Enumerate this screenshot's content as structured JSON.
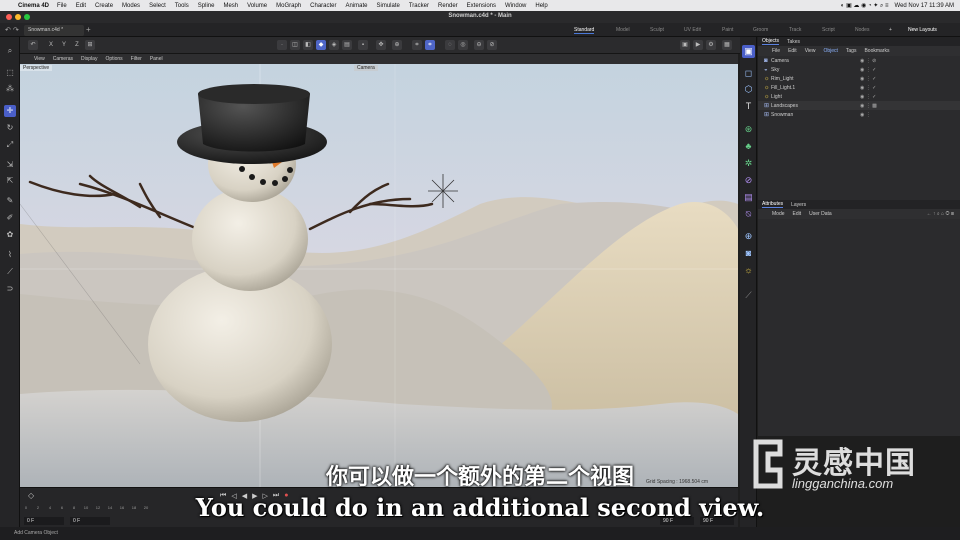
{
  "menubar": {
    "app": "Cinema 4D",
    "items": [
      "File",
      "Edit",
      "Create",
      "Modes",
      "Select",
      "Tools",
      "Spline",
      "Mesh",
      "Volume",
      "MoGraph",
      "Character",
      "Animate",
      "Simulate",
      "Tracker",
      "Render",
      "Extensions",
      "Window",
      "Help"
    ],
    "clock": "Wed Nov 17  11:39 AM"
  },
  "window": {
    "title": "Snowman.c4d * - Main"
  },
  "doc_tab": {
    "label": "Snowman.c4d *"
  },
  "layouts": {
    "items": [
      "Standard",
      "Model",
      "Sculpt",
      "UV Edit",
      "Paint",
      "Groom",
      "Track",
      "Script",
      "Nodes"
    ],
    "new_layouts": "New Layouts"
  },
  "axis_buttons": [
    "X",
    "Y",
    "Z"
  ],
  "viewport": {
    "menu": [
      "View",
      "Cameras",
      "Display",
      "Options",
      "Filter",
      "Panel"
    ],
    "perspective_label": "Perspective",
    "camera_label": "Camera",
    "grid_spacing": "Grid Spacing : 1968.504 cm"
  },
  "objects_panel": {
    "tabs": [
      "Objects",
      "Takes"
    ],
    "menu": [
      "File",
      "Edit",
      "View",
      "Object",
      "Tags",
      "Bookmarks"
    ],
    "items": [
      {
        "name": "Camera",
        "icon": "camera-icon"
      },
      {
        "name": "Sky",
        "icon": "sky-icon"
      },
      {
        "name": "Rim_Light",
        "icon": "light-icon"
      },
      {
        "name": "Fill_Light.1",
        "icon": "light-icon"
      },
      {
        "name": "Light",
        "icon": "light-icon"
      },
      {
        "name": "Landscapes",
        "icon": "null-icon"
      },
      {
        "name": "Snowman",
        "icon": "null-icon"
      }
    ]
  },
  "attributes_panel": {
    "tabs": [
      "Attributes",
      "Layers"
    ],
    "menu": [
      "Mode",
      "Edit",
      "User Data"
    ]
  },
  "timeline": {
    "ticks": [
      "0",
      "2",
      "4",
      "6",
      "8",
      "10",
      "12",
      "14",
      "16",
      "18",
      "20"
    ],
    "start": "0 F",
    "current": "0 F",
    "end": "90 F",
    "end2": "90 F"
  },
  "status": "Add Camera Object",
  "subtitles": {
    "cn": "你可以做一个额外的第二个视图",
    "en": "You could do in an additional second view."
  },
  "watermark": {
    "title": "灵感中国",
    "url": "lingganchina.com"
  },
  "colors": {
    "accent": "#4a5fc9",
    "sky_top": "#c9d7e2",
    "sky_bottom": "#d8c9d8",
    "snow": "#dccfb4"
  }
}
